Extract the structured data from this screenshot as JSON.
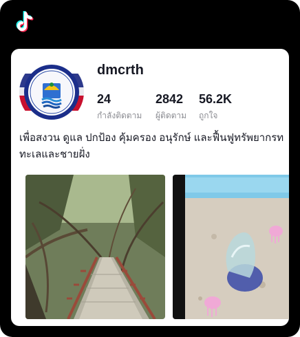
{
  "profile": {
    "username": "dmcrth",
    "stats": [
      {
        "value": "24",
        "label": "กำลังติดตาม"
      },
      {
        "value": "2842",
        "label": "ผู้ติดตาม"
      },
      {
        "value": "56.2K",
        "label": "ถูกใจ"
      }
    ],
    "bio_lines": [
      "เพื่อสงวน ดูแล ปกป้อง คุ้มครอง อนุรักษ์ และฟื้นฟูทรัพยากรท",
      "ทะเลและชายฝั่ง"
    ]
  },
  "colors": {
    "frame": "#000000",
    "card": "#ffffff",
    "text": "#161823",
    "secondary_text": "#8a8b91",
    "tiktok_cyan": "#25F4EE",
    "tiktok_pink": "#FE2C55"
  },
  "icons": {
    "app_logo": "tiktok-logo-icon"
  },
  "videos": [
    {
      "subject": "mangrove-boardwalk-thumbnail"
    },
    {
      "subject": "jellyfish-on-sand-thumbnail"
    }
  ]
}
